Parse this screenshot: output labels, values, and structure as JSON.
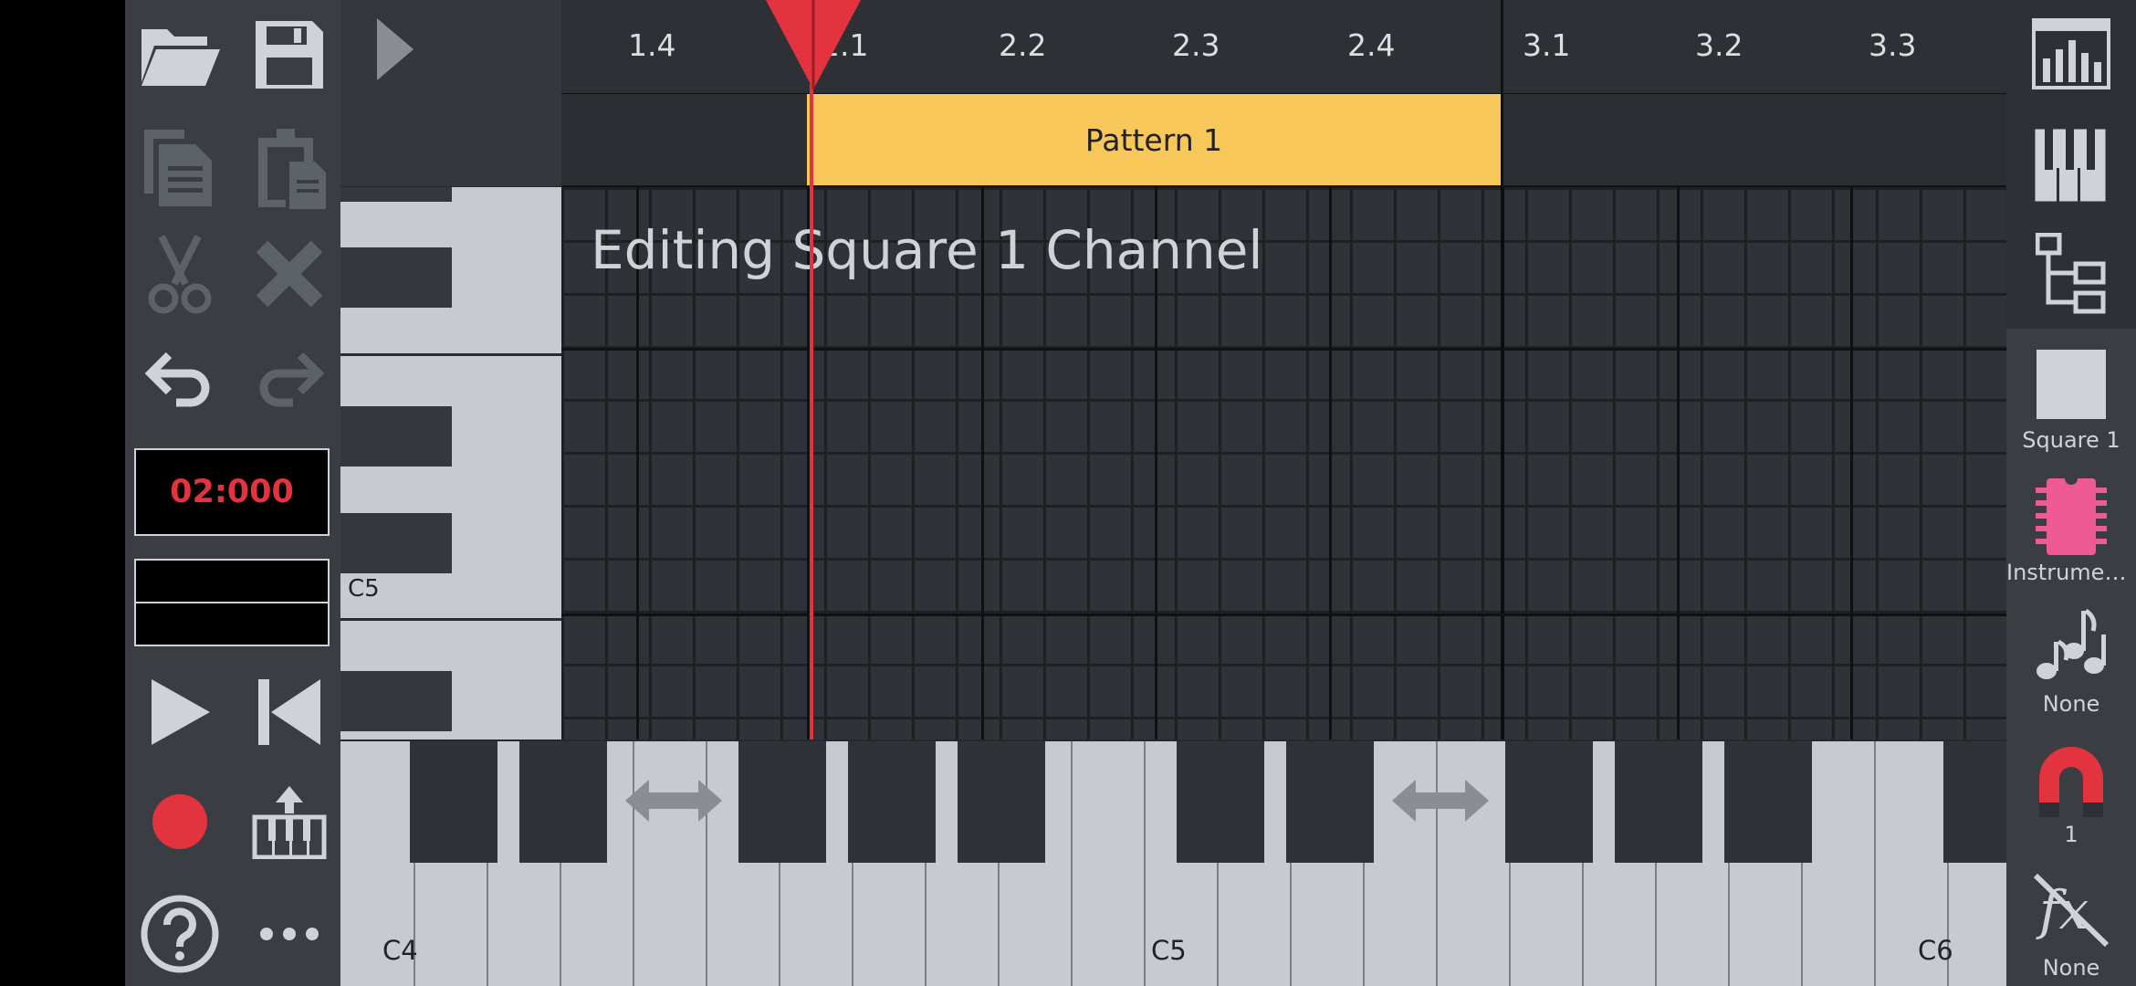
{
  "toolbar": {
    "open_icon": "folder-open-icon",
    "save_icon": "floppy-disk-icon",
    "time_display": "02:000"
  },
  "ruler": {
    "labels": [
      "1.4",
      "2.1",
      "2.2",
      "2.3",
      "2.4",
      "3.1",
      "3.2",
      "3.3"
    ]
  },
  "pattern": {
    "label": "Pattern 1"
  },
  "editor": {
    "status_text": "Editing Square 1 Channel",
    "side_note": "C5"
  },
  "keyboard": {
    "labels": [
      "C4",
      "C5",
      "C6"
    ]
  },
  "right_panel": {
    "channel_label": "Square 1",
    "instrument_label": "Instrument...",
    "notes_label": "None",
    "snap_label": "1",
    "fx_label": "None"
  },
  "colors": {
    "accent_red": "#e2333f",
    "pattern_yellow": "#f7c75a",
    "instrument_pink": "#ee5a92"
  }
}
